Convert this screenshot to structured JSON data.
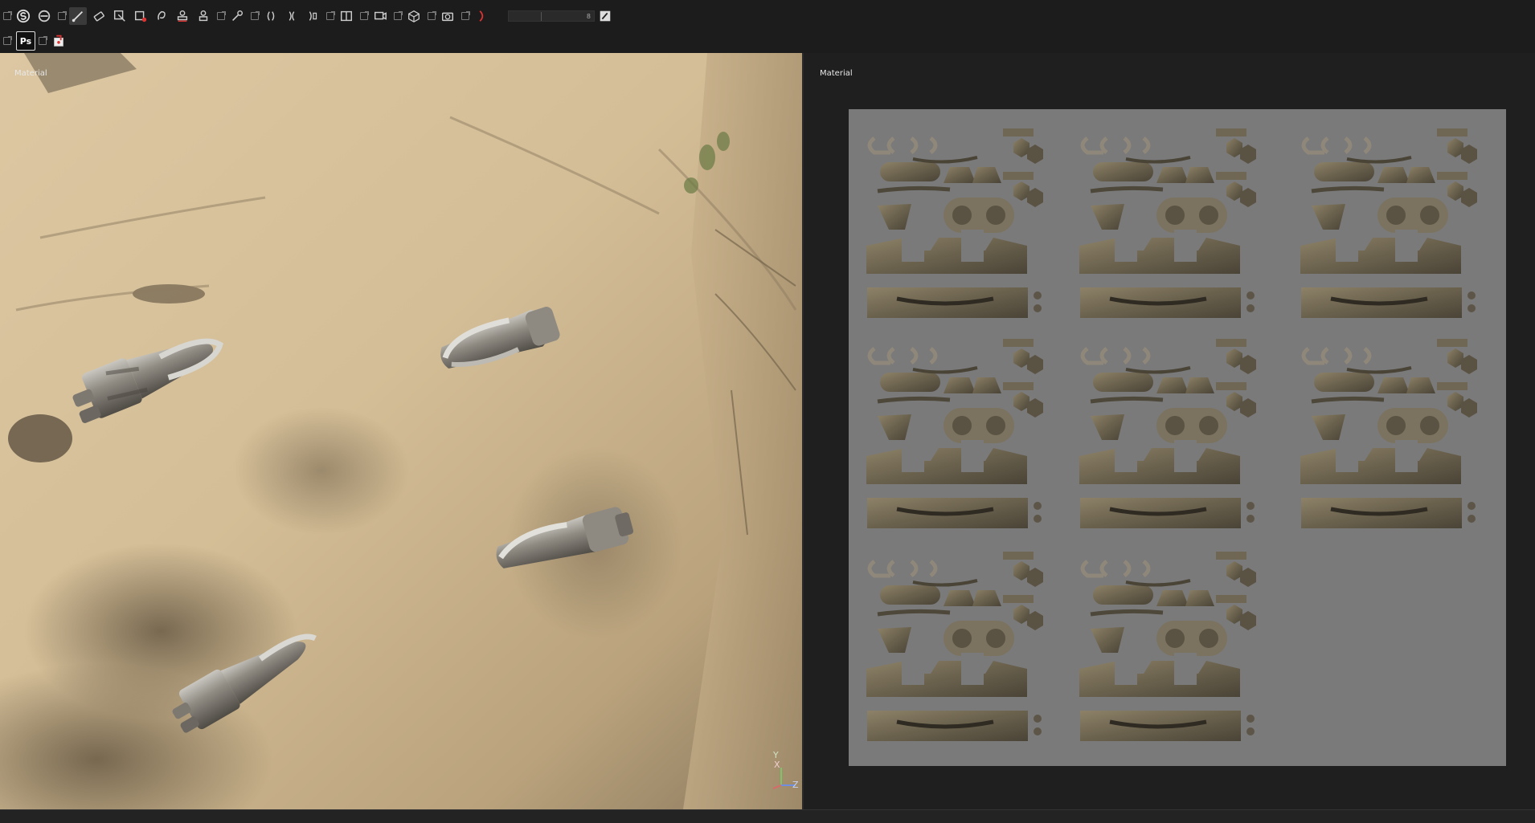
{
  "toolbar": {
    "row1_tools": [
      {
        "icon": "substance-logo-icon",
        "active": false
      },
      {
        "icon": "symmetry-icon",
        "active": false
      },
      {
        "icon": "paint-brush-icon",
        "active": true
      },
      {
        "icon": "eraser-icon",
        "active": false
      },
      {
        "icon": "projection-icon",
        "active": false
      },
      {
        "icon": "polygon-fill-icon",
        "active": false
      },
      {
        "icon": "smudge-icon",
        "active": false
      },
      {
        "icon": "clone-stamp-icon",
        "active": false
      },
      {
        "icon": "material-picker-icon",
        "active": false
      },
      {
        "icon": "color-picker-icon",
        "active": false
      },
      {
        "icon": "mirror-x-icon",
        "active": false
      },
      {
        "icon": "mirror-y-icon",
        "active": false
      },
      {
        "icon": "mirror-z-icon",
        "active": false
      },
      {
        "icon": "2d-3d-view-icon",
        "active": false
      },
      {
        "icon": "camera-view-icon",
        "active": false
      },
      {
        "icon": "cube-view-icon",
        "active": false
      },
      {
        "icon": "screenshot-camera-icon",
        "active": false
      },
      {
        "icon": "render-mode-icon",
        "active": false
      }
    ],
    "slider_value": "8",
    "row2_tools": [
      {
        "icon": "photoshop-icon",
        "label": "Ps"
      },
      {
        "icon": "export-icon",
        "label": ""
      }
    ]
  },
  "viewport_3d": {
    "label": "Material",
    "gizmo_axes": [
      "Y",
      "X",
      "Z"
    ]
  },
  "viewport_2d": {
    "label": "Material"
  },
  "colors": {
    "toolbar_bg": "#1c1c1c",
    "panel_bg": "#1f1f1f",
    "uv_bg": "#7a7a7a",
    "sand": "#d2bd98",
    "metal": "#8a8a86"
  }
}
